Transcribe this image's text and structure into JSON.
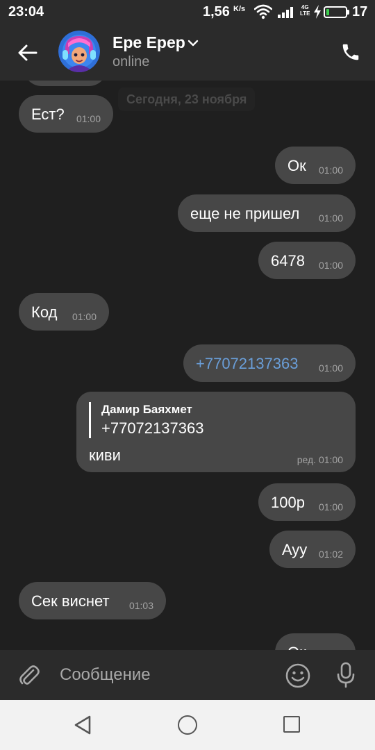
{
  "status_bar": {
    "time": "23:04",
    "network_speed": "1,56",
    "network_speed_unit": "K/s",
    "network_type": "4G LTE",
    "battery": "17",
    "battery_level_percent": 17
  },
  "header": {
    "contact_name": "Ере Ерер",
    "contact_status": "online"
  },
  "chat": {
    "date_divider": "Сегодня, 23 ноября",
    "messages": [
      {
        "text": "Ест?",
        "time": "01:00",
        "direction": "incoming"
      },
      {
        "text": "Ок",
        "time": "01:00",
        "direction": "outgoing"
      },
      {
        "text": "еще не пришел",
        "time": "01:00",
        "direction": "outgoing"
      },
      {
        "text": "6478",
        "time": "01:00",
        "direction": "outgoing"
      },
      {
        "text": "Код",
        "time": "01:00",
        "direction": "incoming"
      },
      {
        "text": "+77072137363",
        "time": "01:00",
        "direction": "outgoing",
        "is_link": true
      },
      {
        "reply_author": "Дамир Баяхмет",
        "reply_quote": "+77072137363",
        "text": "киви",
        "time": "ред. 01:00",
        "direction": "outgoing"
      },
      {
        "text": "100р",
        "time": "01:00",
        "direction": "outgoing"
      },
      {
        "text": "Ayy",
        "time": "01:02",
        "direction": "outgoing"
      },
      {
        "text": "Сек виснет",
        "time": "01:03",
        "direction": "incoming"
      },
      {
        "text": "Ок",
        "time": "",
        "direction": "outgoing"
      }
    ]
  },
  "input": {
    "placeholder": "Сообщение"
  },
  "colors": {
    "background": "#1f1f1f",
    "bar": "#2b2b2b",
    "bubble": "#474747",
    "link": "#6a9ed8"
  }
}
